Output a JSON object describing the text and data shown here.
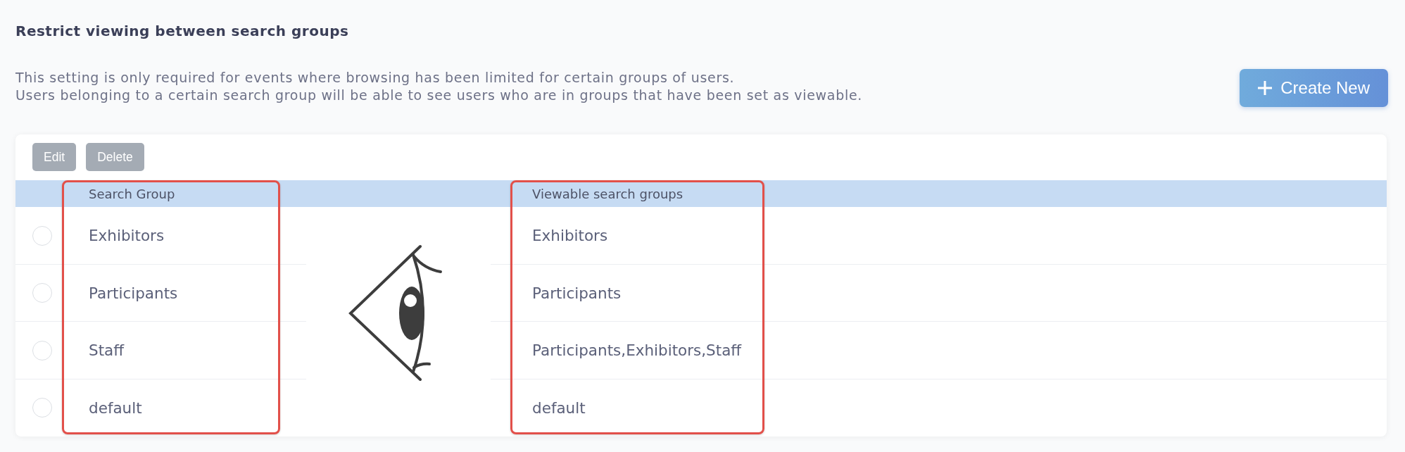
{
  "section": {
    "title": "Restrict viewing between search groups",
    "description": [
      "This setting is only required for events where browsing has been limited for certain groups of users.",
      "Users belonging to a certain search group will be able to see users who are in groups that have been set as viewable."
    ],
    "create_button": {
      "label": "Create New"
    }
  },
  "toolbar": [
    {
      "label": "Edit",
      "disabled": true
    },
    {
      "label": "Delete",
      "disabled": true
    }
  ],
  "table": {
    "columns": [
      {
        "label": "Search Group",
        "highlighted": true
      },
      {
        "label": "Viewable search groups",
        "highlighted": true
      }
    ],
    "rows": [
      {
        "selected": false,
        "cells": [
          "Exhibitors",
          "Exhibitors"
        ]
      },
      {
        "selected": false,
        "cells": [
          "Participants",
          "Participants"
        ]
      },
      {
        "selected": false,
        "cells": [
          "Staff",
          "Participants,Exhibitors,Staff"
        ]
      },
      {
        "selected": false,
        "cells": [
          "default",
          "default"
        ]
      }
    ]
  }
}
